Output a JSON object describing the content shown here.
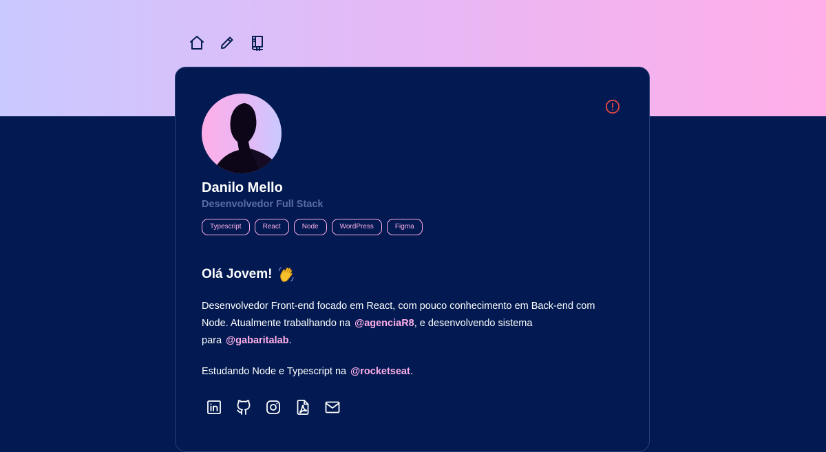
{
  "nav": {
    "items": [
      {
        "name": "home",
        "icon": "home-icon"
      },
      {
        "name": "edit",
        "icon": "pencil-icon"
      },
      {
        "name": "blog",
        "icon": "book-icon"
      }
    ]
  },
  "profile": {
    "name": "Danilo Mello",
    "role": "Desenvolvedor Full Stack",
    "avatar_alt": "avatar-photo",
    "alert_icon": "alert-circle-icon",
    "tags": [
      "Typescript",
      "React",
      "Node",
      "WordPress",
      "Figma"
    ]
  },
  "about": {
    "greeting": "Olá Jovem!",
    "greeting_emoji": "waving-hand-icon",
    "bio_intro": "Desenvolvedor Front-end focado em React, com pouco conhecimento em Back-end com Node. Atualmente trabalhando na",
    "handle_1": "@agenciaR8",
    "bio_mid": ", e desenvolvendo sistema para",
    "handle_2": "@gabaritalab",
    "bio_end": ".",
    "study_text": "Estudando Node e Typescript na",
    "handle_3": "@rocketseat",
    "study_end": "."
  },
  "socials": [
    {
      "name": "linkedin",
      "icon": "linkedin-icon"
    },
    {
      "name": "github",
      "icon": "github-icon"
    },
    {
      "name": "instagram",
      "icon": "instagram-icon"
    },
    {
      "name": "resume-pdf",
      "icon": "pdf-file-icon"
    },
    {
      "name": "email",
      "icon": "mail-icon"
    }
  ],
  "colors": {
    "background": "#021a51",
    "accent_pink": "#ffaee8",
    "gradient_start": "#c9c9ff",
    "gradient_end": "#ffaee8",
    "muted_text": "#5d6ba3",
    "alert": "#e04848"
  }
}
